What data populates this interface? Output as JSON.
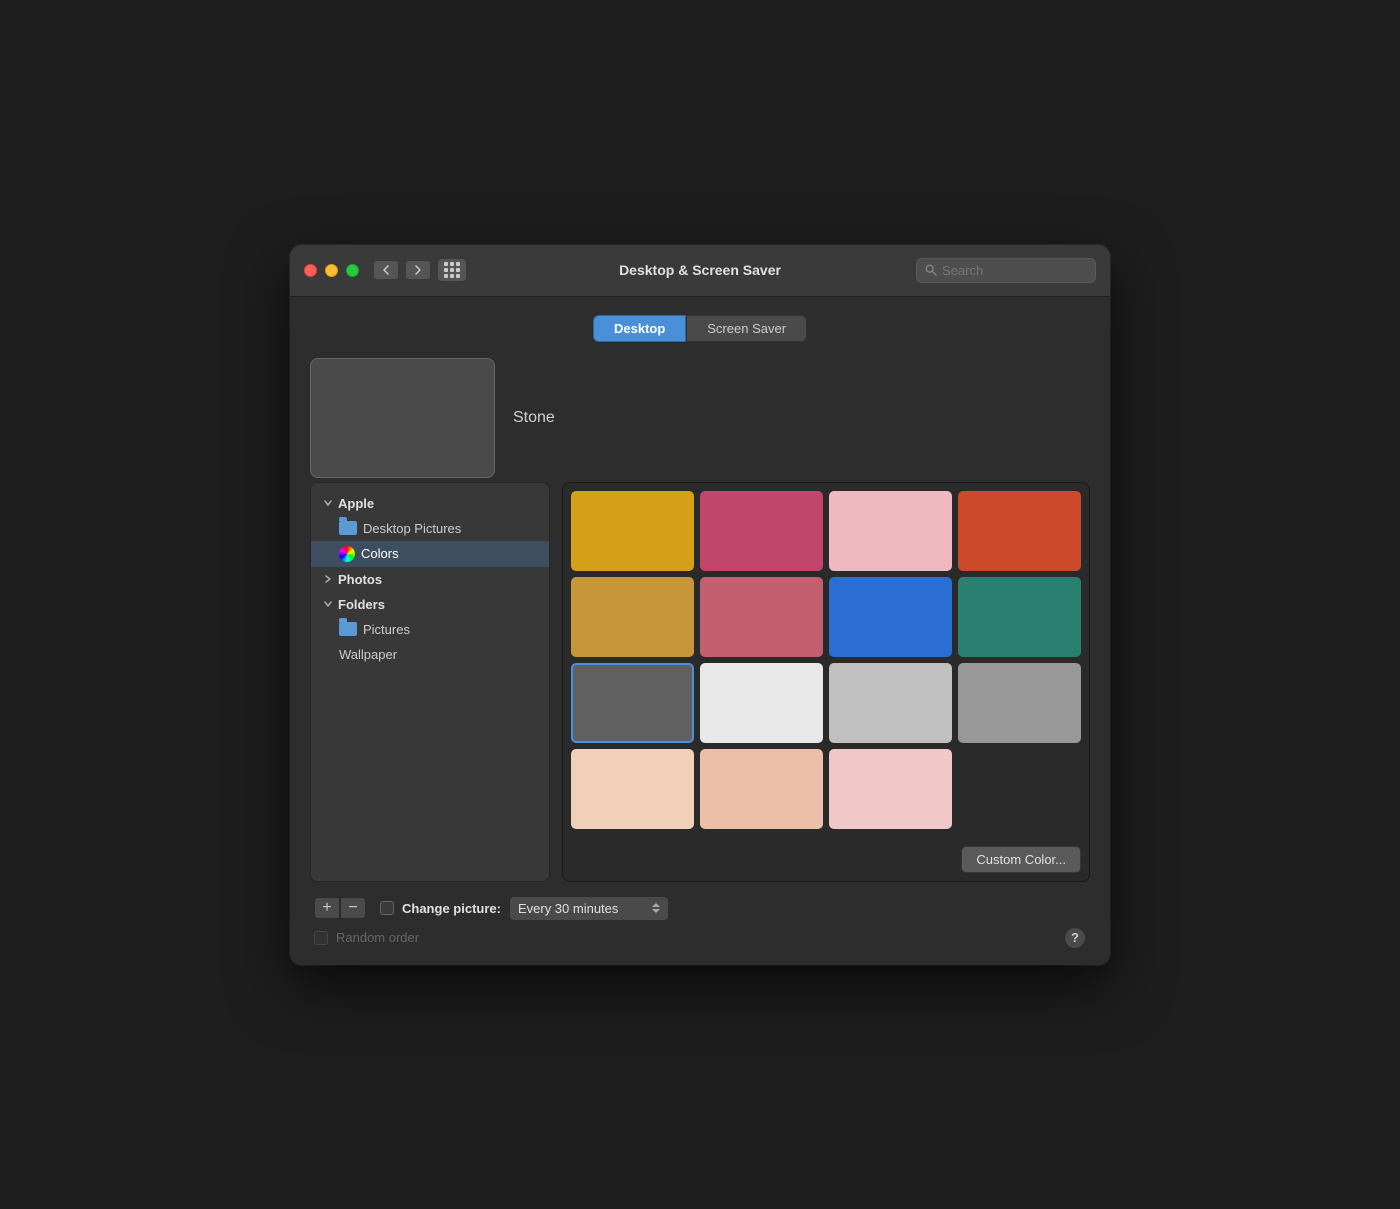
{
  "window": {
    "title": "Desktop & Screen Saver",
    "search_placeholder": "Search"
  },
  "tabs": [
    {
      "id": "desktop",
      "label": "Desktop",
      "active": true
    },
    {
      "id": "screen-saver",
      "label": "Screen Saver",
      "active": false
    }
  ],
  "preview": {
    "name": "Stone"
  },
  "sidebar": {
    "sections": [
      {
        "id": "apple",
        "label": "Apple",
        "expanded": true,
        "items": [
          {
            "id": "desktop-pictures",
            "label": "Desktop Pictures",
            "icon": "folder",
            "active": false
          },
          {
            "id": "colors",
            "label": "Colors",
            "icon": "color-wheel",
            "active": true
          }
        ]
      },
      {
        "id": "photos",
        "label": "Photos",
        "expanded": false,
        "items": []
      },
      {
        "id": "folders",
        "label": "Folders",
        "expanded": true,
        "items": [
          {
            "id": "pictures",
            "label": "Pictures",
            "icon": "folder",
            "active": false
          },
          {
            "id": "wallpaper",
            "label": "Wallpaper",
            "icon": "none",
            "active": false
          }
        ]
      }
    ]
  },
  "color_grid": {
    "swatches": [
      {
        "id": "swatch-1",
        "color": "#D4A017",
        "selected": false
      },
      {
        "id": "swatch-2",
        "color": "#C2456B",
        "selected": false
      },
      {
        "id": "swatch-3",
        "color": "#F0B8C0",
        "selected": false
      },
      {
        "id": "swatch-4",
        "color": "#CC4A2A",
        "selected": false
      },
      {
        "id": "swatch-5",
        "color": "#C8963A",
        "selected": false
      },
      {
        "id": "swatch-6",
        "color": "#C26070",
        "selected": false
      },
      {
        "id": "swatch-7",
        "color": "#2B6FD4",
        "selected": false
      },
      {
        "id": "swatch-8",
        "color": "#2A8070",
        "selected": false
      },
      {
        "id": "swatch-9",
        "color": "#606060",
        "selected": true
      },
      {
        "id": "swatch-10",
        "color": "#E8E8E8",
        "selected": false
      },
      {
        "id": "swatch-11",
        "color": "#C0C0C0",
        "selected": false
      },
      {
        "id": "swatch-12",
        "color": "#989898",
        "selected": false
      },
      {
        "id": "swatch-13",
        "color": "#F0D0B8",
        "selected": false
      },
      {
        "id": "swatch-14",
        "color": "#ECC0A8",
        "selected": false
      },
      {
        "id": "swatch-15",
        "color": "#F0C8C8",
        "selected": false
      },
      {
        "id": "swatch-empty",
        "color": "transparent",
        "selected": false
      }
    ],
    "custom_color_label": "Custom Color..."
  },
  "bottom": {
    "add_label": "+",
    "remove_label": "−",
    "change_picture_label": "Change picture:",
    "interval_label": "Every 30 minutes",
    "random_order_label": "Random order",
    "help_label": "?"
  }
}
